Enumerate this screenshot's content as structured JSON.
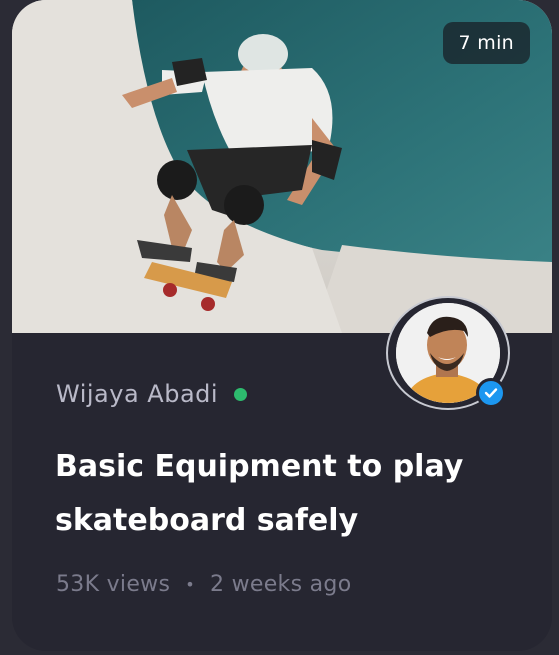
{
  "card": {
    "duration": "7 min",
    "author": {
      "name": "Wijaya Abadi",
      "online": true,
      "verified": true
    },
    "title": "Basic Equipment to play skateboard safely",
    "meta": {
      "views": "53K views",
      "separator": "•",
      "posted": "2 weeks ago"
    }
  },
  "colors": {
    "card_bg": "#262631",
    "accent_verified": "#1c97f0",
    "online": "#2dbb6e",
    "ramp_teal": "#2f6e72"
  }
}
